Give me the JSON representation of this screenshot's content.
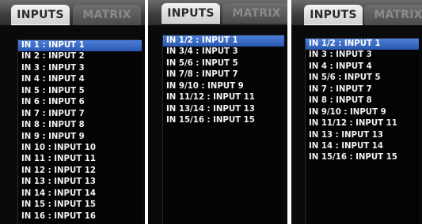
{
  "panels": [
    {
      "tabs": {
        "inputs": "INPUTS",
        "matrix": "MATRIX"
      },
      "items": [
        "IN 1 : INPUT 1",
        "IN 2 : INPUT 2",
        "IN 3 : INPUT 3",
        "IN 4 : INPUT 4",
        "IN 5 : INPUT 5",
        "IN 6 : INPUT 6",
        "IN 7 : INPUT 7",
        "IN 8 : INPUT 8",
        "IN 9 : INPUT 9",
        "IN 10 : INPUT 10",
        "IN 11 : INPUT 11",
        "IN 12 : INPUT 12",
        "IN 13 : INPUT 13",
        "IN 14 : INPUT 14",
        "IN 15 : INPUT 15",
        "IN 16 : INPUT 16"
      ],
      "selected_index": 0
    },
    {
      "tabs": {
        "inputs": "INPUTS",
        "matrix": "MATRIX"
      },
      "items": [
        "IN 1/2 : INPUT 1",
        "IN 3/4 : INPUT 3",
        "IN 5/6 : INPUT 5",
        "IN 7/8 : INPUT 7",
        "IN 9/10 : INPUT 9",
        "IN 11/12 : INPUT 11",
        "IN 13/14 : INPUT 13",
        "IN 15/16 : INPUT 15"
      ],
      "selected_index": 0
    },
    {
      "tabs": {
        "inputs": "INPUTS",
        "matrix": "MATRIX"
      },
      "items": [
        "IN 1/2 : INPUT 1",
        "IN 3 : INPUT 3",
        "IN 4 : INPUT 4",
        "IN 5/6 : INPUT 5",
        "IN 7 : INPUT 7",
        "IN 8 : INPUT 8",
        "IN 9/10 : INPUT 9",
        "IN 11/12 : INPUT 11",
        "IN 13 : INPUT 13",
        "IN 14 : INPUT 14",
        "IN 15/16 : INPUT 15"
      ],
      "selected_index": 0
    }
  ],
  "colors": {
    "selection": "#2d5fb8",
    "list_background": "#040404",
    "text": "#f2f2f2"
  }
}
